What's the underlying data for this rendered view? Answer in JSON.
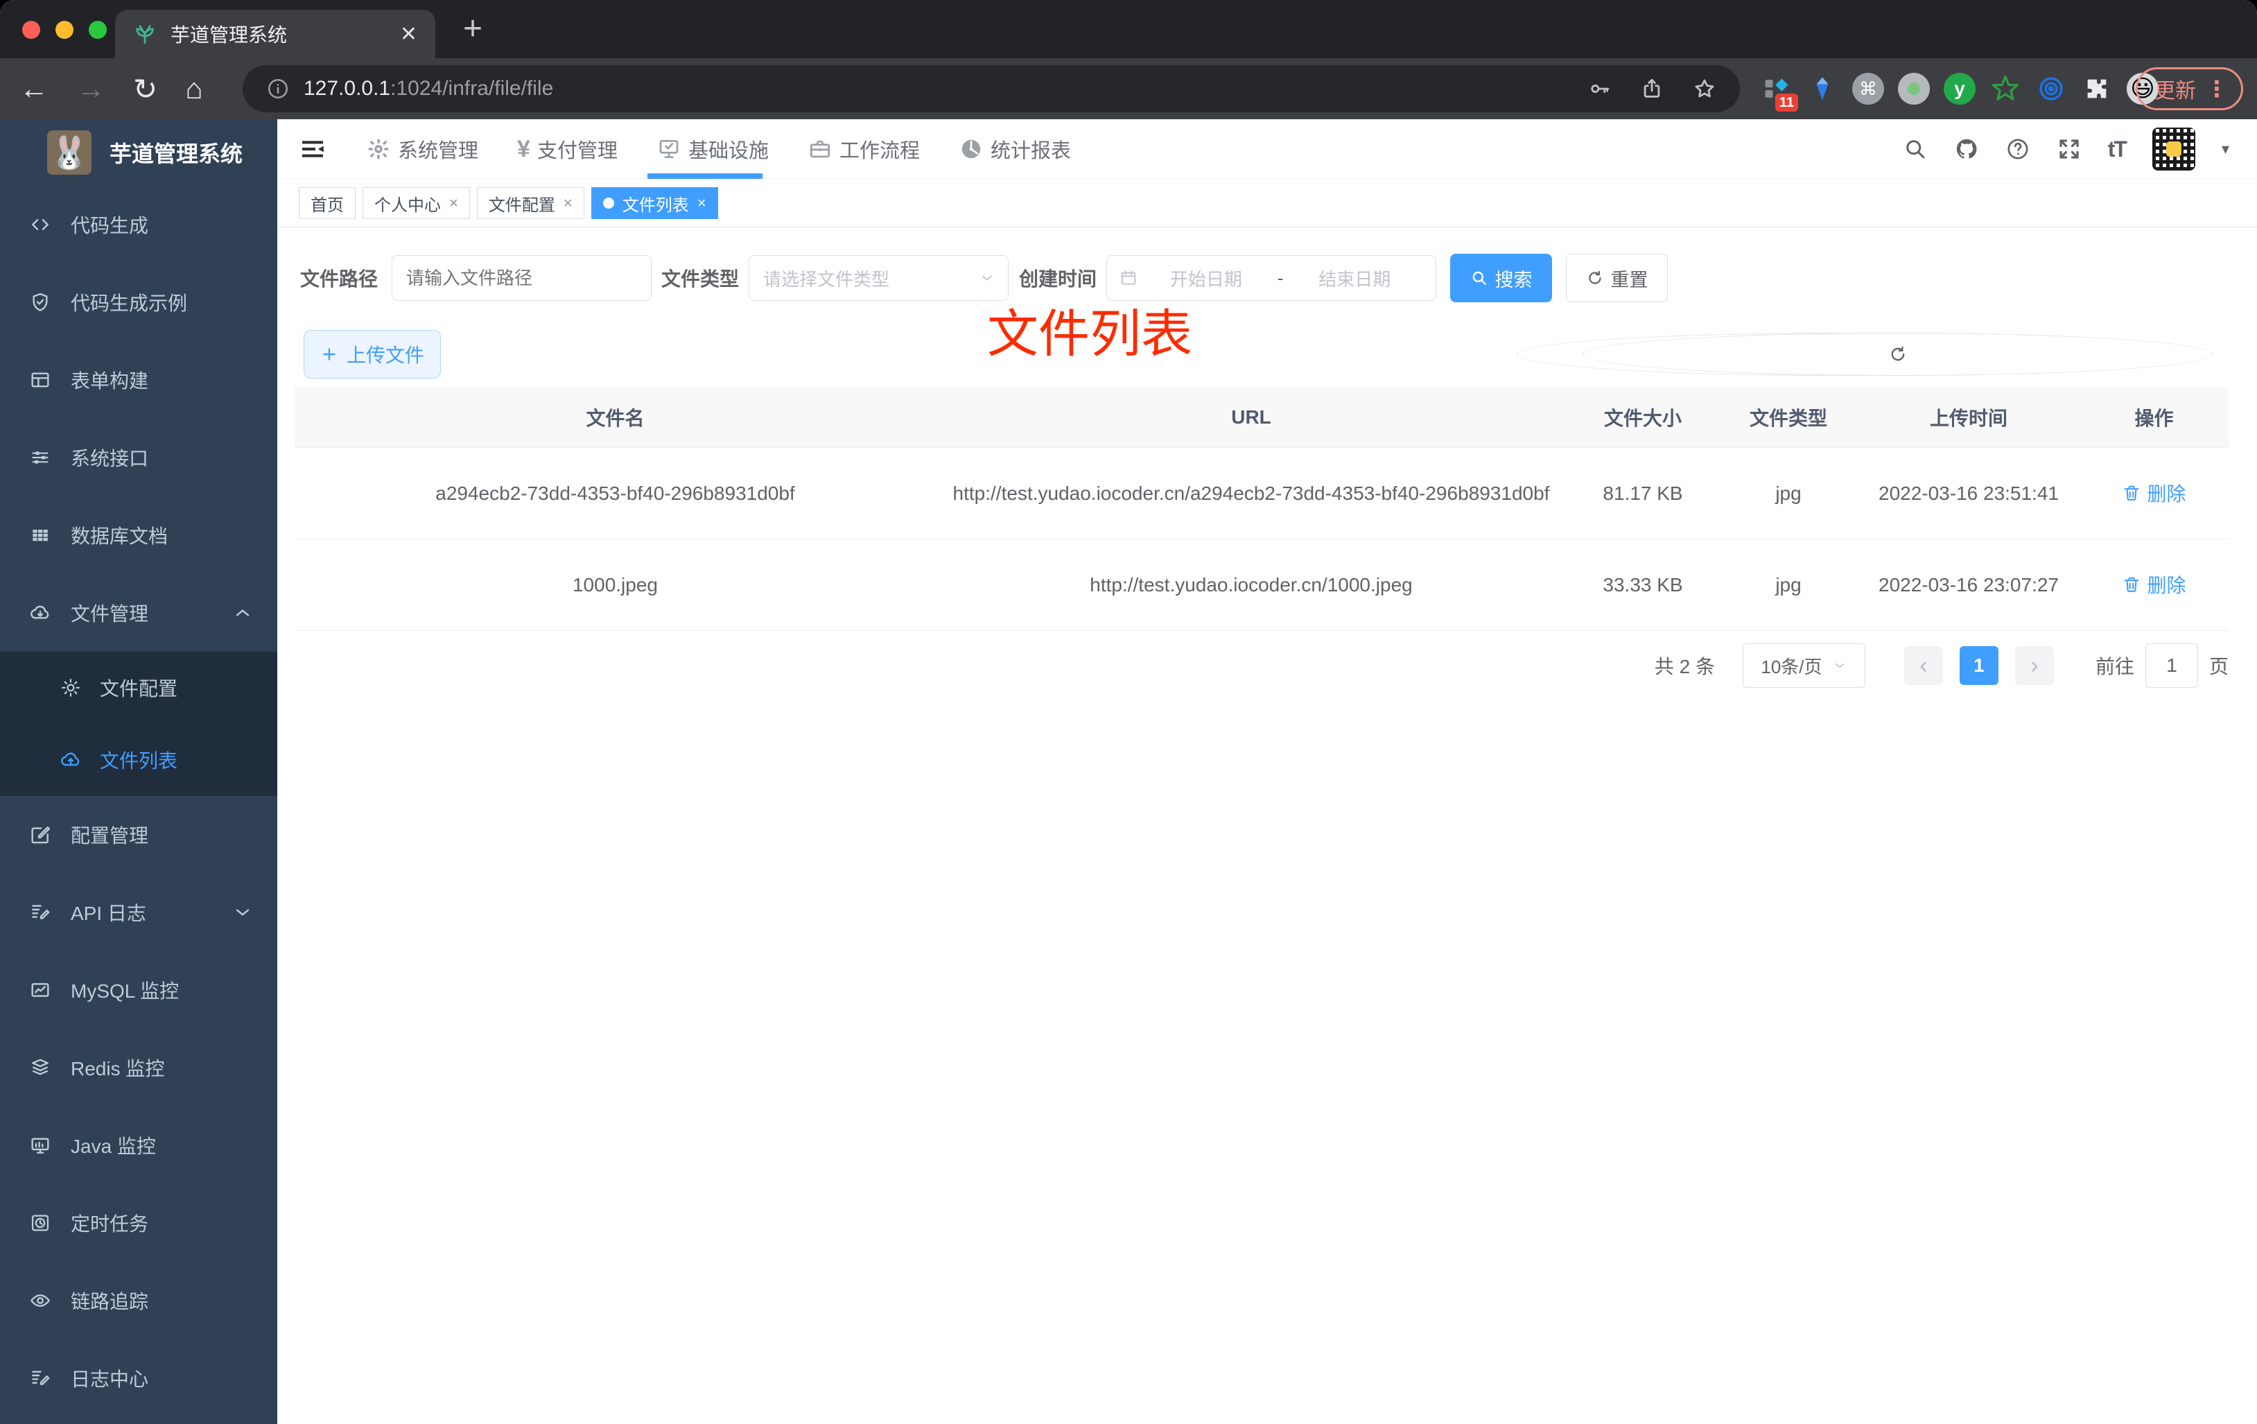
{
  "browser": {
    "tab_title": "芋道管理系统",
    "close_glyph": "✕",
    "new_tab": "+",
    "back": "←",
    "forward": "→",
    "reload": "↻",
    "home": "⌂",
    "url_host": "127.0.0.1",
    "url_rest": ":1024/infra/file/file",
    "extension_badge": "11",
    "ext_cmd": "⌘",
    "ext_y": "y",
    "ext_emoji": "😃",
    "update_label": "更新",
    "menu_dots": "⋮"
  },
  "sidebar": {
    "logo_emoji": "🐰",
    "title": "芋道管理系统",
    "items": [
      {
        "label": "代码生成",
        "icon": "code-icon"
      },
      {
        "label": "代码生成示例",
        "icon": "shield-check-icon"
      },
      {
        "label": "表单构建",
        "icon": "form-icon"
      },
      {
        "label": "系统接口",
        "icon": "sliders-icon"
      },
      {
        "label": "数据库文档",
        "icon": "grid-icon"
      },
      {
        "label": "文件管理",
        "icon": "cloud-download-icon",
        "expanded": true
      }
    ],
    "submenu": [
      {
        "label": "文件配置",
        "icon": "gear-icon",
        "active": false
      },
      {
        "label": "文件列表",
        "icon": "cloud-upload-icon",
        "active": true
      }
    ],
    "items_after": [
      {
        "label": "配置管理",
        "icon": "edit-icon"
      },
      {
        "label": "API 日志",
        "icon": "log-edit-icon",
        "collapsed": true
      },
      {
        "label": "MySQL 监控",
        "icon": "chart-icon"
      },
      {
        "label": "Redis 监控",
        "icon": "layers-icon"
      },
      {
        "label": "Java 监控",
        "icon": "monitor-icon"
      },
      {
        "label": "定时任务",
        "icon": "timer-icon"
      },
      {
        "label": "链路追踪",
        "icon": "eye-icon"
      },
      {
        "label": "日志中心",
        "icon": "log-edit-icon"
      }
    ]
  },
  "navbar": {
    "menus": [
      {
        "label": "系统管理",
        "icon": "gear-icon"
      },
      {
        "label": "支付管理",
        "icon": "yen-icon"
      },
      {
        "label": "基础设施",
        "icon": "infra-monitor-icon",
        "active": true
      },
      {
        "label": "工作流程",
        "icon": "briefcase-icon"
      },
      {
        "label": "统计报表",
        "icon": "gauge-icon"
      }
    ],
    "yen_glyph": "¥",
    "help_glyph": "?",
    "font_icon_text": "tT",
    "caret": "▾"
  },
  "tags": [
    {
      "label": "首页",
      "closable": false,
      "active": false
    },
    {
      "label": "个人中心",
      "closable": true,
      "active": false
    },
    {
      "label": "文件配置",
      "closable": true,
      "active": false
    },
    {
      "label": "文件列表",
      "closable": true,
      "active": true
    }
  ],
  "tag_close_glyph": "×",
  "annotation": "文件列表",
  "filters": {
    "path_label": "文件路径",
    "path_placeholder": "请输入文件路径",
    "type_label": "文件类型",
    "type_placeholder": "请选择文件类型",
    "date_label": "创建时间",
    "date_start_placeholder": "开始日期",
    "date_separator": "-",
    "date_end_placeholder": "结束日期",
    "search_label": "搜索",
    "reset_label": "重置"
  },
  "toolbar": {
    "upload_label": "上传文件"
  },
  "table": {
    "columns": [
      "文件名",
      "URL",
      "文件大小",
      "文件类型",
      "上传时间",
      "操作"
    ],
    "rows": [
      {
        "name": "a294ecb2-73dd-4353-bf40-296b8931d0bf",
        "url": "http://test.yudao.iocoder.cn/a294ecb2-73dd-4353-bf40-296b8931d0bf",
        "size": "81.17 KB",
        "type": "jpg",
        "time": "2022-03-16 23:51:41",
        "action": "删除"
      },
      {
        "name": "1000.jpeg",
        "url": "http://test.yudao.iocoder.cn/1000.jpeg",
        "size": "33.33 KB",
        "type": "jpg",
        "time": "2022-03-16 23:07:27",
        "action": "删除"
      }
    ]
  },
  "pagination": {
    "total": "共 2 条",
    "page_size": "10条/页",
    "prev": "‹",
    "page": "1",
    "next": "›",
    "goto_label": "前往",
    "goto_value": "1",
    "unit": "页"
  },
  "colors": {
    "accent": "#409eff",
    "annotation_red": "#fe2b00",
    "sidebar_bg": "#304156",
    "submenu_bg": "#1f2d3d",
    "tag_active": "#409eff",
    "update_salmon": "#ee8c82",
    "table_header_bg": "#f8f8f9"
  }
}
